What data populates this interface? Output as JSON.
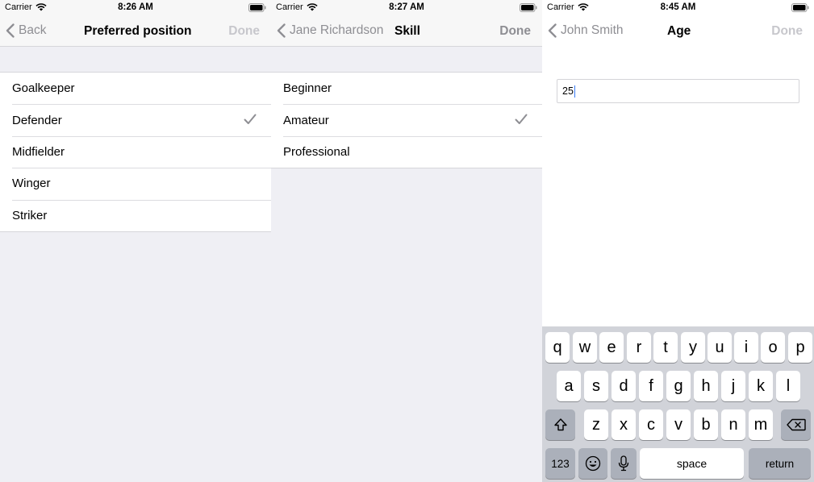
{
  "status_bars": [
    {
      "carrier": "Carrier",
      "time": "8:26 AM"
    },
    {
      "carrier": "Carrier",
      "time": "8:27 AM"
    },
    {
      "carrier": "Carrier",
      "time": "8:45 AM"
    }
  ],
  "screen1": {
    "back_label": "Back",
    "title": "Preferred position",
    "done_label": "Done",
    "done_enabled": false,
    "options": [
      "Goalkeeper",
      "Defender",
      "Midfielder",
      "Winger",
      "Striker"
    ],
    "selected": "Defender"
  },
  "screen2": {
    "back_label": "Jane Richardson",
    "title": "Skill",
    "done_label": "Done",
    "done_enabled": true,
    "options": [
      "Beginner",
      "Amateur",
      "Professional"
    ],
    "selected": "Amateur"
  },
  "screen3": {
    "back_label": "John Smith",
    "title": "Age",
    "done_label": "Done",
    "done_enabled": false,
    "field_value": "25"
  },
  "keyboard": {
    "row1": [
      "q",
      "w",
      "e",
      "r",
      "t",
      "y",
      "u",
      "i",
      "o",
      "p"
    ],
    "row2": [
      "a",
      "s",
      "d",
      "f",
      "g",
      "h",
      "j",
      "k",
      "l"
    ],
    "row3": [
      "z",
      "x",
      "c",
      "v",
      "b",
      "n",
      "m"
    ],
    "numbers_label": "123",
    "space_label": "space",
    "return_label": "return",
    "icons": {
      "shift": "shift-icon",
      "delete": "delete-icon",
      "emoji": "emoji-icon",
      "mic": "microphone-icon"
    }
  },
  "colors": {
    "background": "#efeff4",
    "nav_gray": "#8e8e93",
    "disabled": "#c7c7cc",
    "keyboard_bg": "#d1d3d9",
    "function_key": "#abb0ba"
  }
}
